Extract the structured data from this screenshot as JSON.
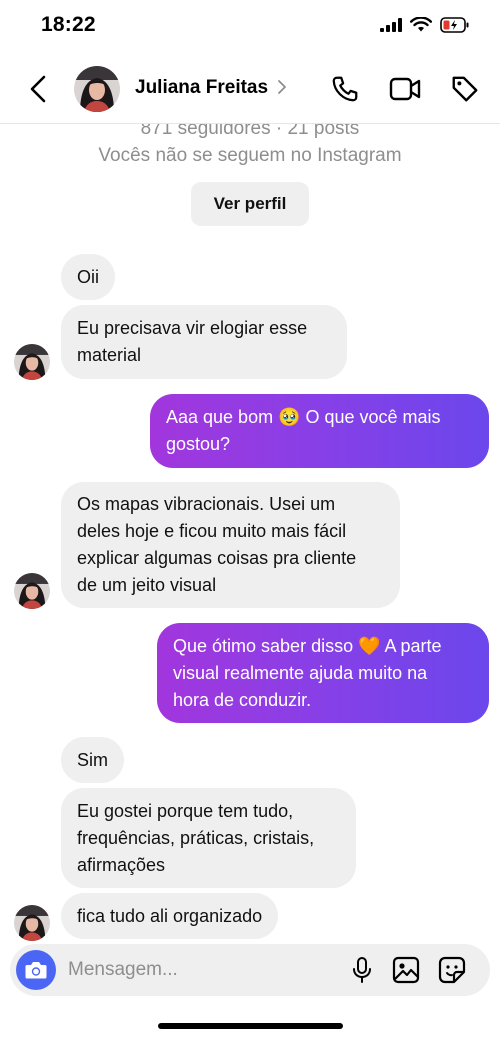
{
  "status": {
    "time": "18:22"
  },
  "header": {
    "contact_name": "Juliana Freitas",
    "icons": [
      "back-icon",
      "phone-icon",
      "video-icon",
      "tag-icon"
    ]
  },
  "profile": {
    "followers_line": "871 seguidores · 21 posts",
    "follow_status": "Vocês não se seguem no Instagram",
    "view_profile_label": "Ver perfil"
  },
  "messages": [
    {
      "from": "them",
      "lines": [
        "Oii"
      ]
    },
    {
      "from": "them",
      "lines": [
        "Eu precisava vir elogiar esse",
        "material"
      ]
    },
    {
      "from": "me",
      "lines": [
        "Aaa que bom 🥹 O que você mais",
        "gostou?"
      ]
    },
    {
      "from": "them",
      "lines": [
        "Os mapas vibracionais. Usei um",
        "deles hoje e ficou muito mais fácil",
        "explicar algumas coisas pra cliente",
        "de um jeito visual"
      ]
    },
    {
      "from": "me",
      "lines": [
        "Que ótimo saber disso 🧡 A parte",
        "visual realmente ajuda muito na",
        "hora de conduzir."
      ]
    },
    {
      "from": "them",
      "lines": [
        "Sim"
      ]
    },
    {
      "from": "them",
      "lines": [
        "Eu gostei porque tem tudo,",
        "frequências, práticas, cristais,",
        "afirmações"
      ]
    },
    {
      "from": "them",
      "lines": [
        "fica tudo ali organizado"
      ]
    }
  ],
  "composer": {
    "placeholder": "Mensagem...",
    "icons": [
      "camera-icon",
      "microphone-icon",
      "gallery-icon",
      "sticker-icon"
    ]
  },
  "colors": {
    "accent_gradient": [
      "#a236dd",
      "#6b47ec"
    ],
    "camera_button": "#4b66f5",
    "incoming_bubble": "#efefef"
  }
}
